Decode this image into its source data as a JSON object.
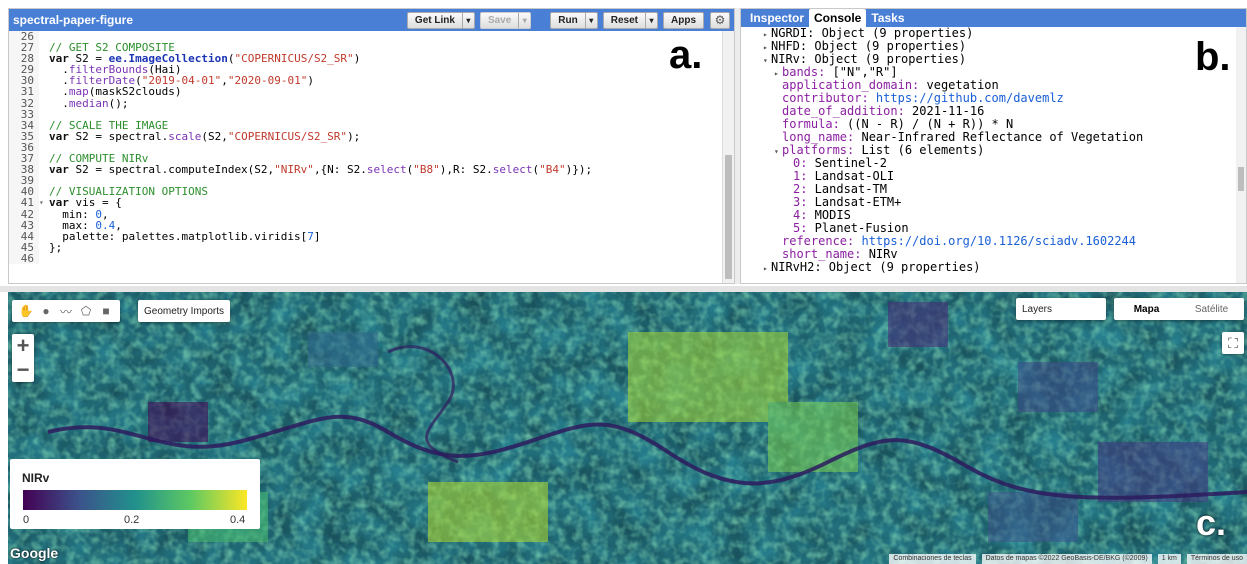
{
  "editor": {
    "title": "spectral-paper-figure",
    "buttons": {
      "get_link": "Get Link",
      "save": "Save",
      "run": "Run",
      "reset": "Reset",
      "apps": "Apps"
    },
    "panel_tag": "a.",
    "code_lines": [
      {
        "n": "26",
        "t": ""
      },
      {
        "n": "27",
        "t": "// GET S2 COMPOSITE"
      },
      {
        "n": "28",
        "t": "var S2 = ee.ImageCollection(\"COPERNICUS/S2_SR\")"
      },
      {
        "n": "29",
        "t": "  .filterBounds(Hai)"
      },
      {
        "n": "30",
        "t": "  .filterDate(\"2019-04-01\",\"2020-09-01\")"
      },
      {
        "n": "31",
        "t": "  .map(maskS2clouds)"
      },
      {
        "n": "32",
        "t": "  .median();"
      },
      {
        "n": "33",
        "t": ""
      },
      {
        "n": "34",
        "t": "// SCALE THE IMAGE"
      },
      {
        "n": "35",
        "t": "var S2 = spectral.scale(S2,\"COPERNICUS/S2_SR\");"
      },
      {
        "n": "36",
        "t": ""
      },
      {
        "n": "37",
        "t": "// COMPUTE NIRv"
      },
      {
        "n": "38",
        "t": "var S2 = spectral.computeIndex(S2,\"NIRv\",{N: S2.select(\"B8\"),R: S2.select(\"B4\")});"
      },
      {
        "n": "39",
        "t": ""
      },
      {
        "n": "40",
        "t": "// VISUALIZATION OPTIONS"
      },
      {
        "n": "41",
        "t": "var vis = {"
      },
      {
        "n": "42",
        "t": "  min: 0,"
      },
      {
        "n": "43",
        "t": "  max: 0.4,"
      },
      {
        "n": "44",
        "t": "  palette: palettes.matplotlib.viridis[7]"
      },
      {
        "n": "45",
        "t": "};"
      },
      {
        "n": "46",
        "t": ""
      }
    ]
  },
  "console": {
    "tabs": [
      "Inspector",
      "Console",
      "Tasks"
    ],
    "panel_tag": "b.",
    "lines": [
      {
        "i": 0,
        "tri": "▸",
        "t": "NGRDI: Object (9 properties)"
      },
      {
        "i": 0,
        "tri": "▸",
        "t": "NHFD: Object (9 properties)"
      },
      {
        "i": 0,
        "tri": "▾",
        "t": "NIRv: Object (9 properties)"
      },
      {
        "i": 1,
        "tri": "▸",
        "k": "bands:",
        "v": " [\"N\",\"R\"]"
      },
      {
        "i": 1,
        "tri": "",
        "k": "application_domain:",
        "v": " vegetation"
      },
      {
        "i": 1,
        "tri": "",
        "k": "contributor:",
        "l": " https://github.com/davemlz"
      },
      {
        "i": 1,
        "tri": "",
        "k": "date_of_addition:",
        "v": " 2021-11-16"
      },
      {
        "i": 1,
        "tri": "",
        "k": "formula:",
        "v": " ((N - R) / (N + R)) * N"
      },
      {
        "i": 1,
        "tri": "",
        "k": "long_name:",
        "v": " Near-Infrared Reflectance of Vegetation"
      },
      {
        "i": 1,
        "tri": "▾",
        "k": "platforms:",
        "v": " List (6 elements)"
      },
      {
        "i": 2,
        "tri": "",
        "k": "0:",
        "v": " Sentinel-2"
      },
      {
        "i": 2,
        "tri": "",
        "k": "1:",
        "v": " Landsat-OLI"
      },
      {
        "i": 2,
        "tri": "",
        "k": "2:",
        "v": " Landsat-TM"
      },
      {
        "i": 2,
        "tri": "",
        "k": "3:",
        "v": " Landsat-ETM+"
      },
      {
        "i": 2,
        "tri": "",
        "k": "4:",
        "v": " MODIS"
      },
      {
        "i": 2,
        "tri": "",
        "k": "5:",
        "v": " Planet-Fusion"
      },
      {
        "i": 1,
        "tri": "",
        "k": "reference:",
        "l": " https://doi.org/10.1126/sciadv.1602244"
      },
      {
        "i": 1,
        "tri": "",
        "k": "short_name:",
        "v": " NIRv"
      },
      {
        "i": 0,
        "tri": "▸",
        "t": "NIRvH2: Object (9 properties)"
      }
    ]
  },
  "map": {
    "panel_tag": "c.",
    "geometry_imports": "Geometry Imports",
    "layers": "Layers",
    "map_types": {
      "map": "Mapa",
      "satellite": "Satélite"
    },
    "zoom_in": "+",
    "zoom_out": "−",
    "legend": {
      "title": "NIRv",
      "min": "0",
      "mid": "0.2",
      "max": "0.4",
      "colors": [
        "#440154",
        "#3b528b",
        "#21918c",
        "#5ec962",
        "#fde725"
      ]
    },
    "google": "Google",
    "attribution": {
      "shortcuts": "Combinaciones de teclas",
      "data": "Datos de mapas ©2022 GeoBasis-DE/BKG (©2009)",
      "scale": "1 km",
      "terms": "Términos de uso"
    }
  }
}
